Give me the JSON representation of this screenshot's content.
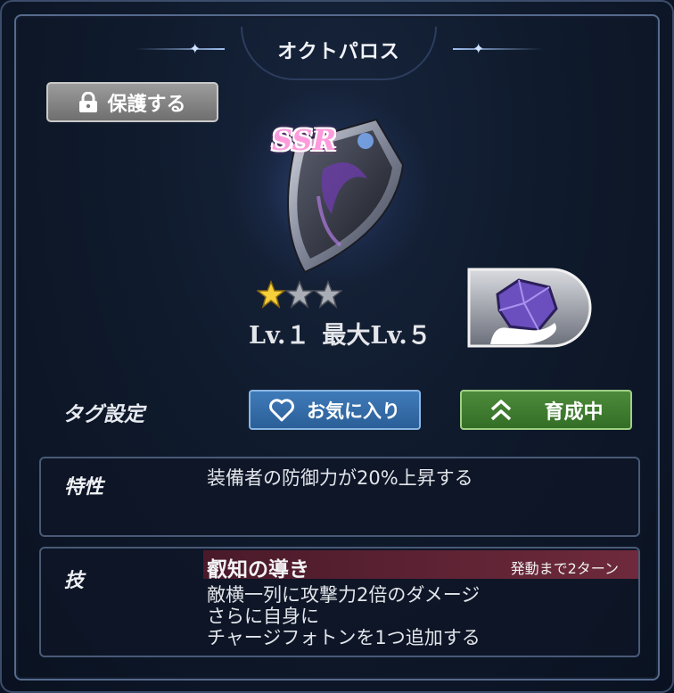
{
  "header": {
    "title": "オクトパロス"
  },
  "protect_button": {
    "label": "保護する",
    "icon": "lock-icon"
  },
  "item": {
    "rarity": "SSR",
    "stars_filled": 1,
    "stars_total": 3,
    "level_text": "Lv.１",
    "max_level_text": "最大Lv.５",
    "category_icon": "gem-in-hand-icon"
  },
  "tags": {
    "label": "タグ設定",
    "favorite_label": "お気に入り",
    "training_label": "育成中"
  },
  "trait": {
    "heading": "特性",
    "text": "装備者の防御力が20%上昇する"
  },
  "skill": {
    "heading": "技",
    "name": "叡知の導き",
    "cooldown": "発動まで2ターン",
    "description": [
      "敵横一列に攻撃力2倍のダメージ",
      "さらに自身に",
      "チャージフォトンを1つ追加する"
    ]
  },
  "colors": {
    "background": "#0b1424",
    "rarity_pink": "#ff9adc",
    "favorite_blue": "#2b5f98",
    "training_green": "#336e26",
    "skill_bar": "#6e2a3c"
  }
}
